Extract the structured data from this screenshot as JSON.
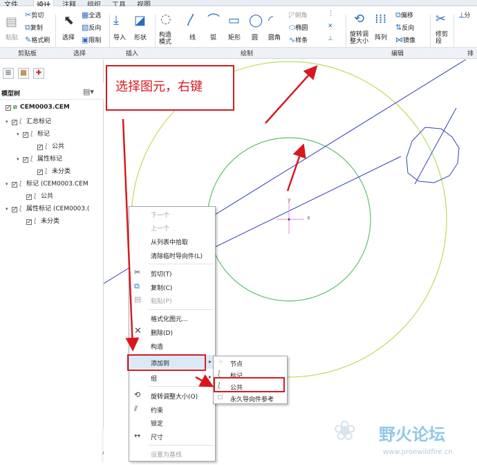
{
  "tabs": [
    "文件",
    "设计",
    "注释",
    "组织",
    "工具",
    "视图"
  ],
  "active_tab": "设计",
  "ribbon": {
    "clipboard": {
      "paste": "粘贴",
      "cut": "剪切",
      "copy": "复制",
      "format_painter": "格式刷",
      "group": "剪贴板"
    },
    "select": {
      "select": "选择",
      "select_all": "全选",
      "invert": "反向",
      "limit": "限制",
      "group": "选择"
    },
    "insert": {
      "import": "导入",
      "shape": "形状",
      "group": "插入"
    },
    "sketch": {
      "construction_mode": "构造\n模式",
      "line": "线",
      "arc": "弧",
      "rectangle": "矩形",
      "circle": "圆",
      "fillet": "圆角",
      "chamfer": "倒角",
      "ellipse": "椭圆",
      "spline": "样条",
      "group": "绘制"
    },
    "edit": {
      "rotate_resize": "旋转调\n整大小",
      "pattern": "阵列",
      "offset": "偏移",
      "reverse": "反向",
      "mirror": "镜像",
      "group": "编辑"
    },
    "right": {
      "trim_segment": "修剪\n段",
      "split": "分",
      "arrange": "排"
    }
  },
  "model_tree": {
    "title": "模型树",
    "nodes": [
      {
        "label": "CEM0003.CEM",
        "bold": true
      },
      {
        "label": "汇总标记"
      },
      {
        "label": "标记"
      },
      {
        "label": "公共"
      },
      {
        "label": "属性标记"
      },
      {
        "label": "未分类"
      },
      {
        "label": "标记 (CEM0003.CEM"
      },
      {
        "label": "公共"
      },
      {
        "label": "属性标记 (CEM0003.("
      },
      {
        "label": "未分类"
      }
    ]
  },
  "annotation": {
    "text": "选择图元，右键"
  },
  "context_menu": {
    "items": [
      {
        "label": "下一个",
        "enabled": false
      },
      {
        "label": "上一个",
        "enabled": false
      },
      {
        "label": "从列表中拾取",
        "enabled": true
      },
      {
        "label": "清除临时导向件(L)",
        "enabled": true
      },
      {
        "label": "剪切(T)",
        "enabled": true,
        "icon": "scissors-icon"
      },
      {
        "label": "复制(C)",
        "enabled": true,
        "icon": "copy-icon"
      },
      {
        "label": "粘贴(P)",
        "enabled": false,
        "icon": "paste-icon"
      },
      {
        "label": "格式化图元...",
        "enabled": true
      },
      {
        "label": "删除(D)",
        "enabled": true,
        "icon": "delete-icon"
      },
      {
        "label": "构造",
        "enabled": true
      },
      {
        "label": "添加到",
        "enabled": true,
        "submenu": true
      },
      {
        "label": "组",
        "enabled": true,
        "submenu": true
      },
      {
        "label": "旋转调整大小(O)",
        "enabled": true,
        "icon": "rotate-icon"
      },
      {
        "label": "约束",
        "enabled": true,
        "icon": "constraint-icon"
      },
      {
        "label": "锁定",
        "enabled": true
      },
      {
        "label": "尺寸",
        "enabled": true,
        "icon": "dimension-icon"
      },
      {
        "label": "设置为基线",
        "enabled": false
      }
    ]
  },
  "submenu": {
    "items": [
      "节点",
      "标记",
      "公共",
      "永久导向件参考"
    ]
  },
  "canvas": {
    "axis_x": "x",
    "axis_y": "y"
  },
  "watermark": {
    "title": "野火论坛",
    "url": "www.proewildfire.cn"
  },
  "colors": {
    "accent": "#d7191f",
    "circle_outer": "#b8dd5a",
    "circle_inner": "#5bbf6a",
    "lines": "#2f3fbf"
  }
}
